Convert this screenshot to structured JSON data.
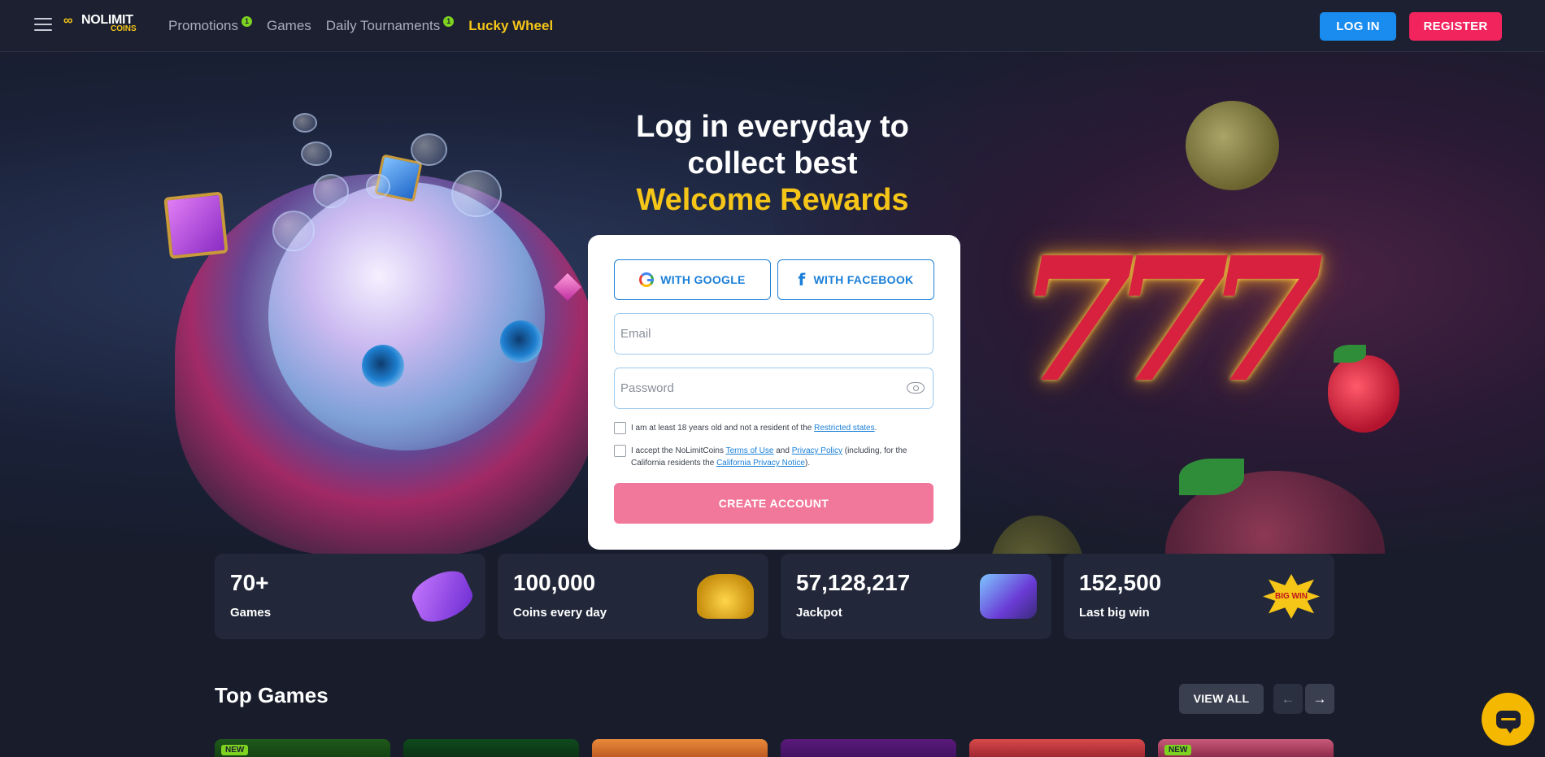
{
  "header": {
    "logo_main": "NOLIMIT",
    "logo_sub": "COINS",
    "nav": [
      {
        "label": "Promotions",
        "badge": "1"
      },
      {
        "label": "Games"
      },
      {
        "label": "Daily Tournaments",
        "badge": "1"
      },
      {
        "label": "Lucky Wheel"
      }
    ],
    "login_label": "LOG IN",
    "register_label": "REGISTER"
  },
  "hero": {
    "title_line1": "Log in everyday to",
    "title_line2": "collect best",
    "title_accent": "Welcome Rewards"
  },
  "form": {
    "google_label": "WITH GOOGLE",
    "facebook_label": "WITH FACEBOOK",
    "email_placeholder": "Email",
    "password_placeholder": "Password",
    "age_check_text": "I am at least 18 years old and not a resident of the",
    "age_check_link": "Restricted states",
    "age_check_end": ".",
    "terms_text_1": "I accept the NoLimitCoins",
    "terms_link_1": "Terms of Use",
    "terms_text_2": "and",
    "terms_link_2": "Privacy Policy",
    "terms_text_3": "(including, for the California residents the",
    "terms_link_3": "California Privacy Notice",
    "terms_text_4": ").",
    "create_label": "CREATE ACCOUNT"
  },
  "stats": [
    {
      "value": "70+",
      "label": "Games",
      "icon": "slot-reel-icon"
    },
    {
      "value": "100,000",
      "label": "Coins every day",
      "icon": "coins-icon"
    },
    {
      "value": "57,128,217",
      "label": "Jackpot",
      "icon": "jackpot-chest-icon"
    },
    {
      "value": "152,500",
      "label": "Last big win",
      "icon": "big-win-icon",
      "icon_text": "BIG WIN"
    }
  ],
  "top_games": {
    "title": "Top Games",
    "view_all_label": "VIEW ALL",
    "prev_icon": "←",
    "next_icon": "→",
    "new_tag": "NEW"
  },
  "colors": {
    "accent_yellow": "#f5c518",
    "login_blue": "#1a8cf0",
    "register_pink": "#f2245e",
    "create_pink": "#f2789b",
    "badge_green": "#7ed321"
  }
}
